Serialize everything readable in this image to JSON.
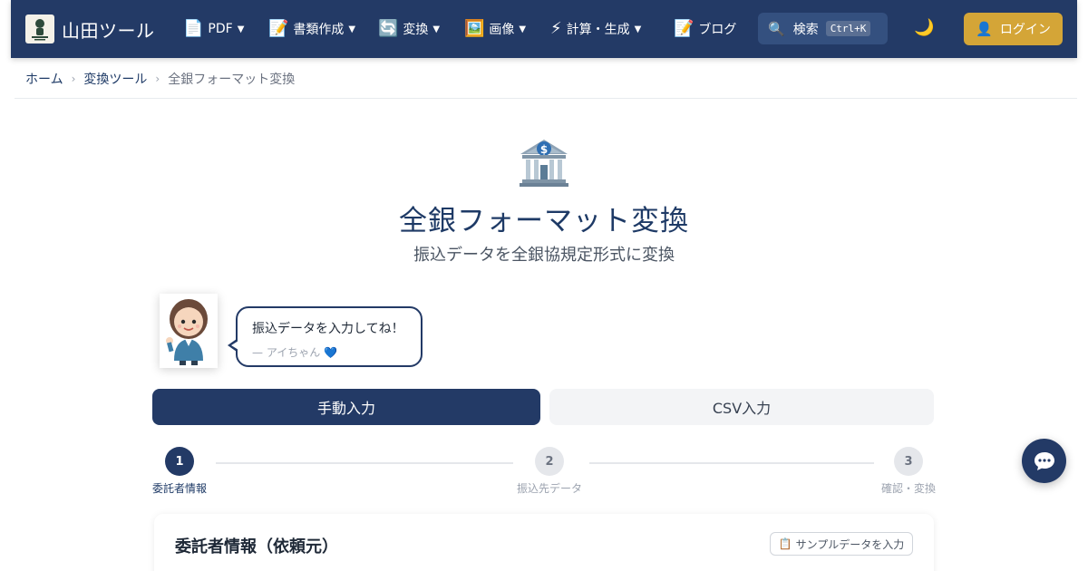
{
  "header": {
    "brand": "山田ツール",
    "nav": [
      {
        "icon": "📄",
        "icon_name": "document-icon",
        "label": "PDF",
        "caret": "▼"
      },
      {
        "icon": "📝",
        "icon_name": "memo-icon",
        "label": "書類作成",
        "caret": "▼"
      },
      {
        "icon": "🔄",
        "icon_name": "convert-icon",
        "label": "変換",
        "caret": "▼"
      },
      {
        "icon": "🖼️",
        "icon_name": "image-icon",
        "label": "画像",
        "caret": "▼"
      },
      {
        "icon": "⚡",
        "icon_name": "lightning-icon",
        "label": "計算・生成",
        "caret": "▼"
      },
      {
        "icon": "📝",
        "icon_name": "memo-icon",
        "label": "ブログ",
        "caret": ""
      }
    ],
    "search": {
      "icon": "🔍",
      "label": "検索",
      "shortcut": "Ctrl+K"
    },
    "theme_icon": "🌙",
    "login": {
      "icon": "👤",
      "label": "ログイン"
    }
  },
  "breadcrumb": {
    "items": [
      "ホーム",
      "変換ツール",
      "全銀フォーマット変換"
    ],
    "separator": "›"
  },
  "hero": {
    "icon": "bank-icon",
    "title": "全銀フォーマット変換",
    "subtitle": "振込データを全銀協規定形式に変換"
  },
  "mascot": {
    "message": "振込データを入力してね！",
    "signature": "— アイちゃん",
    "heart": "💙"
  },
  "tabs": [
    {
      "label": "手動入力",
      "active": true
    },
    {
      "label": "CSV入力",
      "active": false
    }
  ],
  "steps": [
    {
      "number": "1",
      "label": "委託者情報",
      "active": true
    },
    {
      "number": "2",
      "label": "振込先データ",
      "active": false
    },
    {
      "number": "3",
      "label": "確認・変換",
      "active": false
    }
  ],
  "form": {
    "title": "委託者情報（依頼元）",
    "sample_button": {
      "icon": "📋",
      "label": "サンプルデータを入力"
    }
  },
  "colors": {
    "primary": "#233a66",
    "accent": "#d4a537",
    "muted": "#e5e7eb"
  }
}
